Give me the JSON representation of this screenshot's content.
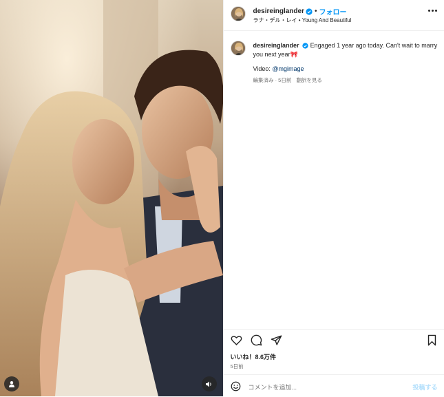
{
  "post": {
    "username": "desireinglander",
    "separator": "•",
    "follow_label": "フォロー",
    "audio": "ラナ・デル・レイ • Young And Beautiful",
    "caption_username": "desireinglander",
    "caption_text": "Engaged 1 year ago today. Can't wait to marry you next year🎀",
    "credit_prefix": "Video:",
    "credit_mention": "@mgimage",
    "edited_time": "編集済み · 5日前",
    "see_translation": "翻訳を見る",
    "likes": "いいね！8.6万件",
    "date": "5日前",
    "comment_placeholder": "コメントを追加...",
    "post_label": "投稿する"
  },
  "icons": {
    "verified": "verified-badge-icon",
    "more": "more-options-icon",
    "like": "heart-icon",
    "comment": "comment-icon",
    "share": "share-icon",
    "save": "bookmark-icon",
    "emoji": "emoji-icon",
    "tagged_users": "user-icon",
    "sound": "speaker-icon"
  },
  "colors": {
    "accent": "#0095f6",
    "verified": "#0095f6",
    "text": "#262626",
    "secondary": "#737373",
    "post_disabled": "#b2dffc"
  }
}
